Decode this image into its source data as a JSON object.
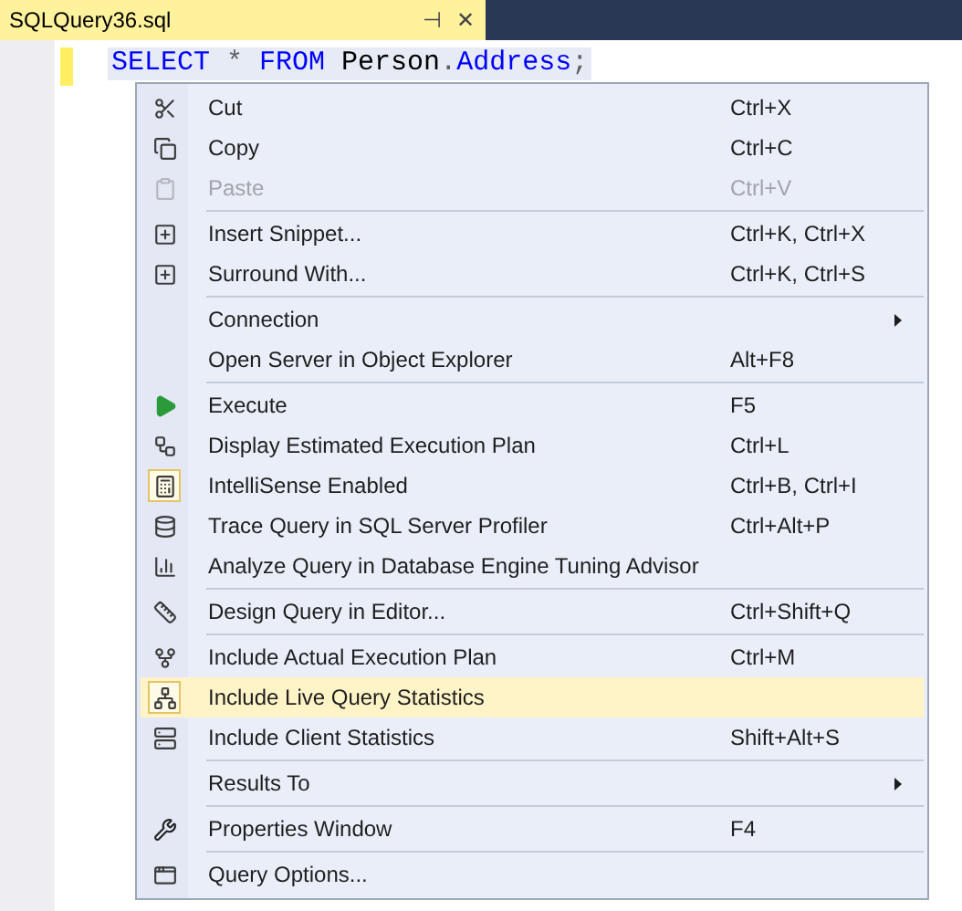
{
  "tab": {
    "title": "SQLQuery36.sql",
    "pin": "⊣",
    "close": "✕"
  },
  "code": [
    {
      "text": "SELECT ",
      "kind": "keyword"
    },
    {
      "text": "* ",
      "kind": "operator"
    },
    {
      "text": "FROM ",
      "kind": "keyword"
    },
    {
      "text": "Person",
      "kind": "ident"
    },
    {
      "text": ".",
      "kind": "operator"
    },
    {
      "text": "Address",
      "kind": "keyword"
    },
    {
      "text": ";",
      "kind": "operator"
    }
  ],
  "menu": [
    [
      {
        "label": "Cut",
        "shortcut": "Ctrl+X",
        "disabled": false
      },
      {
        "label": "Copy",
        "shortcut": "Ctrl+C",
        "disabled": false
      },
      {
        "label": "Paste",
        "shortcut": "Ctrl+V",
        "disabled": true
      }
    ],
    [
      {
        "label": "Insert Snippet...",
        "shortcut": "Ctrl+K, Ctrl+X"
      },
      {
        "label": "Surround With...",
        "shortcut": "Ctrl+K, Ctrl+S"
      }
    ],
    [
      {
        "label": "Connection",
        "submenu": true
      },
      {
        "label": "Open Server in Object Explorer",
        "shortcut": "Alt+F8"
      }
    ],
    [
      {
        "label": "Execute",
        "shortcut": "F5"
      },
      {
        "label": "Display Estimated Execution Plan",
        "shortcut": "Ctrl+L"
      },
      {
        "label": "IntelliSense Enabled",
        "shortcut": "Ctrl+B, Ctrl+I",
        "checked": true
      },
      {
        "label": "Trace Query in SQL Server Profiler",
        "shortcut": "Ctrl+Alt+P"
      },
      {
        "label": "Analyze Query in Database Engine Tuning Advisor"
      }
    ],
    [
      {
        "label": "Design Query in Editor...",
        "shortcut": "Ctrl+Shift+Q"
      }
    ],
    [
      {
        "label": "Include Actual Execution Plan",
        "shortcut": "Ctrl+M",
        "checked": false
      },
      {
        "label": "Include Live Query Statistics",
        "checked": true,
        "selected": true
      },
      {
        "label": "Include Client Statistics",
        "shortcut": "Shift+Alt+S",
        "checked": false
      }
    ],
    [
      {
        "label": "Results To",
        "submenu": true
      }
    ],
    [
      {
        "label": "Properties Window",
        "shortcut": "F4"
      }
    ],
    [
      {
        "label": "Query Options..."
      }
    ]
  ]
}
